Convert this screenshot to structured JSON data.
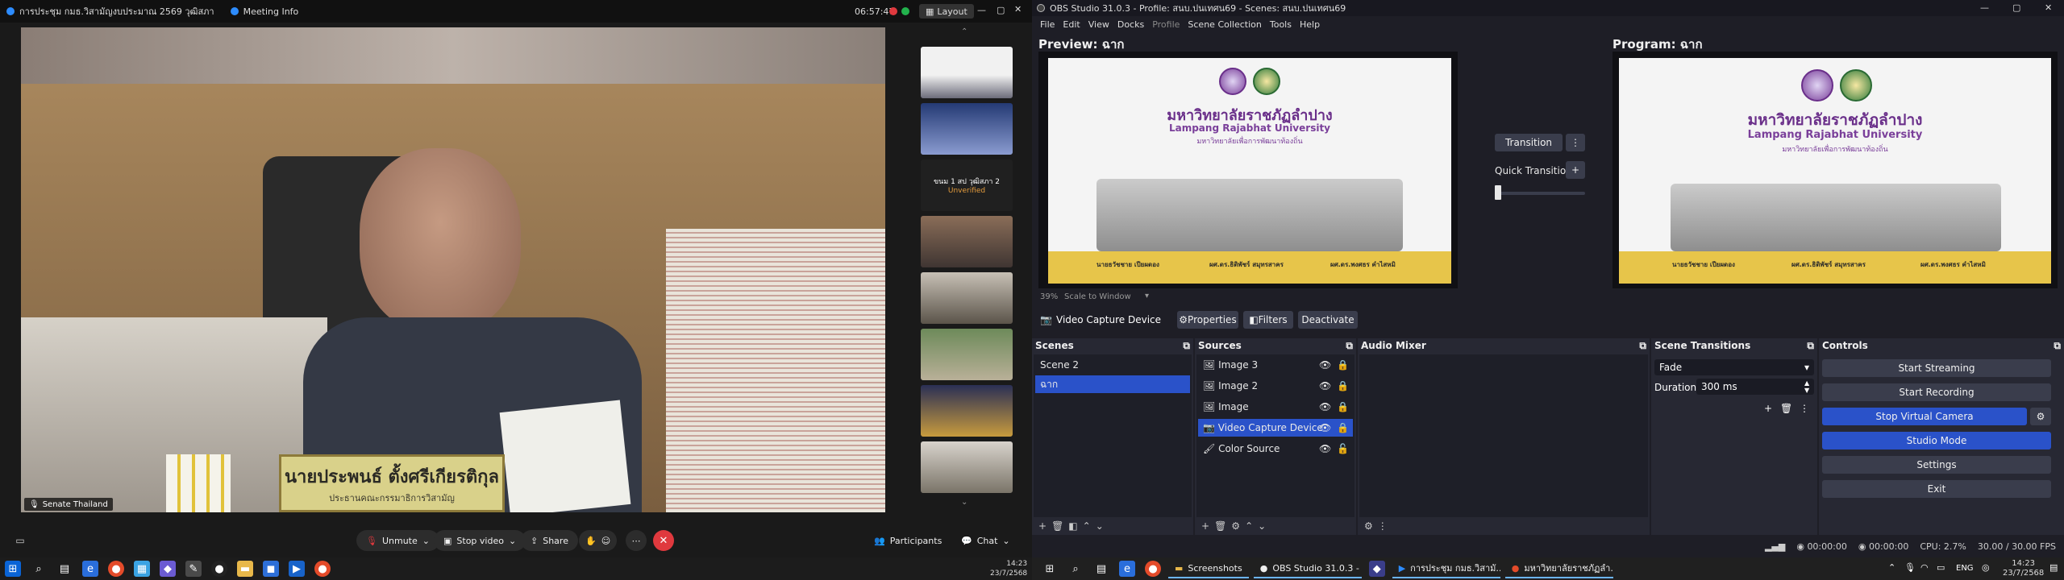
{
  "meeting": {
    "title": "การประชุม กมธ.วิสามัญงบประมาณ 2569 วุฒิสภา",
    "meeting_info": "Meeting Info",
    "clock": "06:57:47",
    "layout_label": "Layout",
    "nameplate": "นายประพนธ์ ตั้งศรีเกียรติกุล",
    "nameplate_sub": "ประธานคณะกรรมาธิการวิสามัญ",
    "participant_tag": "Senate Thailand",
    "thumb_text": "ขนม 1 สป วุฒิสภา 2",
    "thumb_status": "Unverified",
    "toolbar": {
      "unmute": "Unmute",
      "stop_video": "Stop video",
      "share": "Share",
      "participants": "Participants",
      "chat": "Chat"
    }
  },
  "left_taskbar": {
    "time": "14:23",
    "date": "23/7/2568"
  },
  "obs": {
    "title": "OBS Studio 31.0.3 - Profile: สนบ.ปนเทศน69 - Scenes: สนบ.ปนเทศน69",
    "menu": [
      "File",
      "Edit",
      "View",
      "Docks",
      "Profile",
      "Scene Collection",
      "Tools",
      "Help"
    ],
    "preview_label": "Preview: ฉาก",
    "program_label": "Program: ฉาก",
    "university_thai": "มหาวิทยาลัยราชภัฏลำปาง",
    "university_en": "Lampang Rajabhat University",
    "university_motto": "มหาวิทยาลัยเพื่อการพัฒนาท้องถิ่น",
    "person1": "นายธวัชชาย เปียผดอง",
    "person2": "ผศ.ดร.ธิติพัชร์ สมุทรสาคร",
    "person3": "ผศ.ดร.พงศธร คำไสหมิ",
    "zoom": "39%",
    "scale_mode": "Scale to Window",
    "transition_button": "Transition",
    "quick_transitions": "Quick Transitions",
    "source_toolbar": {
      "source_name": "Video Capture Device",
      "properties": "Properties",
      "filters": "Filters",
      "deactivate": "Deactivate"
    },
    "docks": {
      "scenes_title": "Scenes",
      "sources_title": "Sources",
      "audio_title": "Audio Mixer",
      "transitions_title": "Scene Transitions",
      "controls_title": "Controls"
    },
    "scenes": [
      "Scene 2",
      "ฉาก"
    ],
    "sources": [
      "Image 3",
      "Image 2",
      "Image",
      "Video Capture Device",
      "Color Source"
    ],
    "transition": {
      "type": "Fade",
      "duration_label": "Duration",
      "duration_value": "300 ms"
    },
    "controls": [
      "Start Streaming",
      "Start Recording",
      "Stop Virtual Camera",
      "Studio Mode",
      "Settings",
      "Exit"
    ],
    "status": {
      "stream_time": "00:00:00",
      "rec_time": "00:00:00",
      "cpu": "CPU: 2.7%",
      "fps": "30.00 / 30.00 FPS"
    }
  },
  "right_taskbar": {
    "apps": [
      "Screenshots",
      "OBS Studio 31.0.3 - ...",
      "การประชุม กมธ.วิสามั...",
      "มหาวิทยาลัยราชภัฏลำ..."
    ],
    "lang": "ENG",
    "time": "14:23",
    "date": "23/7/2568"
  }
}
